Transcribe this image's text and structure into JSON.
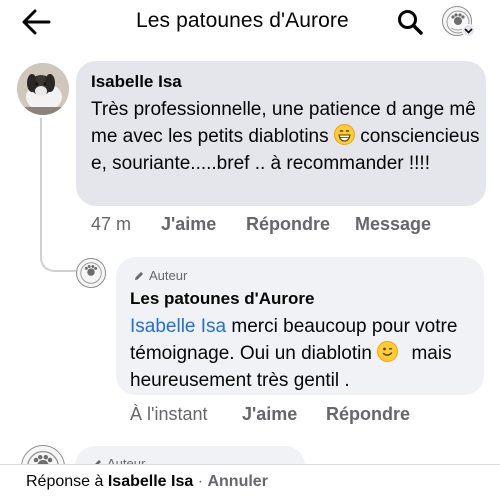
{
  "header": {
    "title": "Les patounes d'Aurore",
    "back_icon": "back-arrow-icon",
    "search_icon": "search-icon"
  },
  "comment": {
    "author": "Isabelle Isa",
    "text": "Très professionnelle, une patience d ange même avec les petits diablotins",
    "text_after_emoji": "consciencieuse, souriante.....bref .. à recommander !!!!",
    "emoji": "grinning-face-emoji",
    "time": "47 m",
    "like_label": "J'aime",
    "reply_label": "Répondre",
    "message_label": "Message"
  },
  "reply": {
    "badge": "Auteur",
    "author": "Les patounes d'Aurore",
    "mention": "Isabelle Isa",
    "text_part1": "merci  beaucoup  pour votre témoignage. Oui un diablotin",
    "emoji": "winking-face-emoji",
    "text_part2": "mais heureusement  très gentil .",
    "time": "À l'instant",
    "like_label": "J'aime",
    "reply_label": "Répondre"
  },
  "next_comment": {
    "badge": "Auteur"
  },
  "reply_bar": {
    "prefix": "Réponse à",
    "name": "Isabelle Isa",
    "separator": "·",
    "cancel_label": "Annuler"
  },
  "colors": {
    "mention": "#216fdb",
    "secondary_text": "#65676b",
    "bubble_primary": "#e4e6eb",
    "bubble_reply": "#f0f2f5"
  }
}
